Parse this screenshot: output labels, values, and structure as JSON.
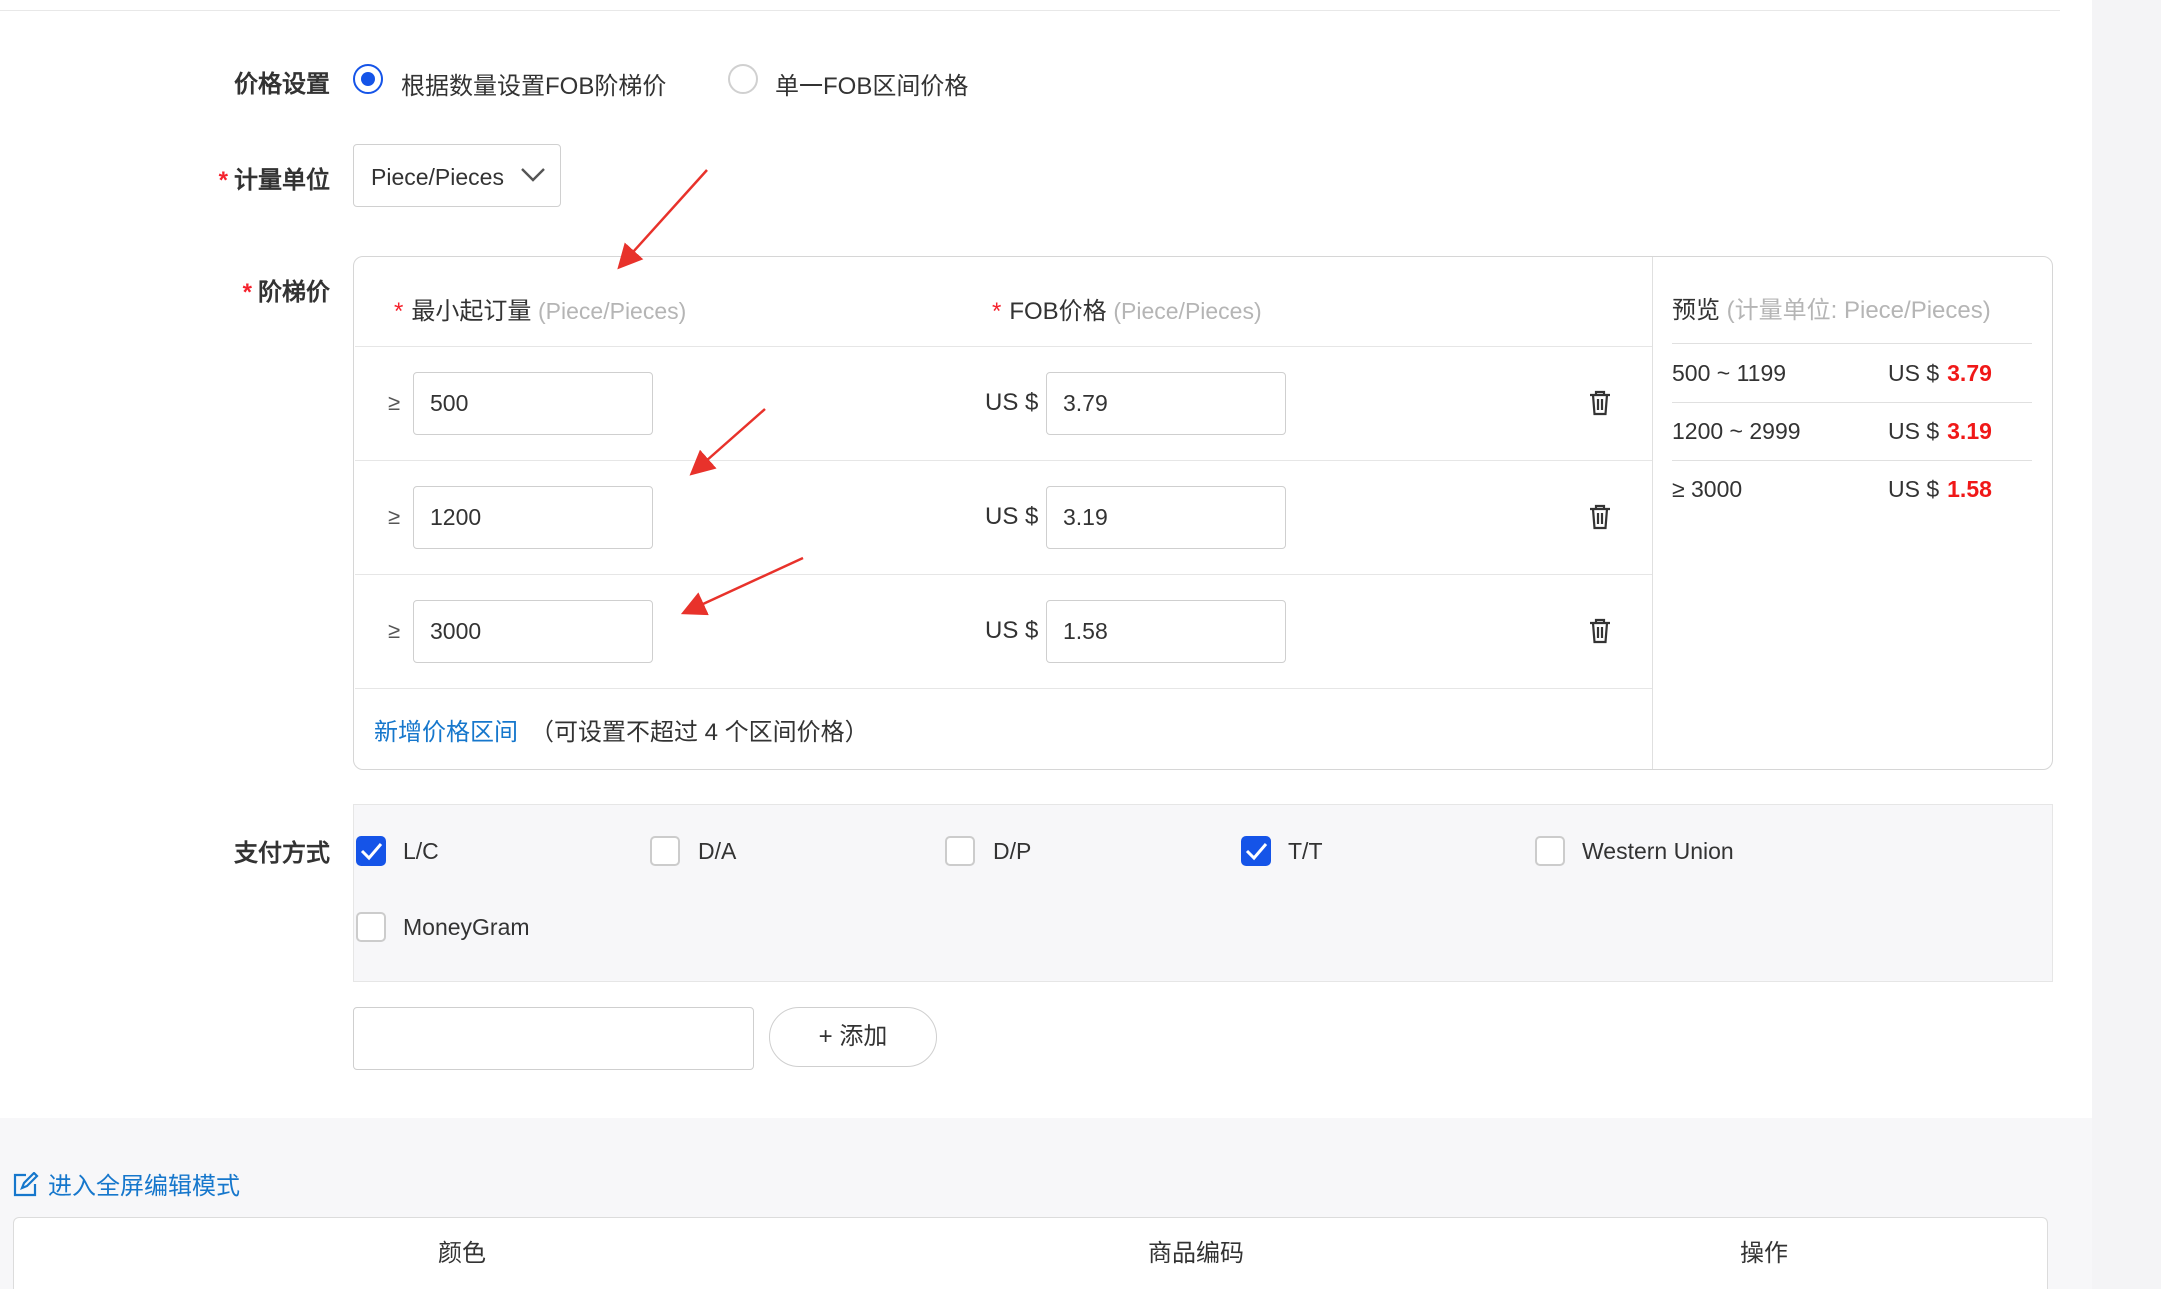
{
  "pricing": {
    "label": "价格设置",
    "options": [
      {
        "label": "根据数量设置FOB阶梯价",
        "selected": true
      },
      {
        "label": "单一FOB区间价格",
        "selected": false
      }
    ]
  },
  "unit": {
    "required_mark": "*",
    "label": "计量单位",
    "value": "Piece/Pieces"
  },
  "tiers": {
    "required_mark": "*",
    "label": "阶梯价",
    "min_qty_header": "最小起订量",
    "min_qty_unit": "(Piece/Pieces)",
    "price_header": "FOB价格",
    "price_unit": "(Piece/Pieces)",
    "ge_symbol": "≥",
    "currency": "US $",
    "rows": [
      {
        "min_qty": "500",
        "price": "3.79"
      },
      {
        "min_qty": "1200",
        "price": "3.19"
      },
      {
        "min_qty": "3000",
        "price": "1.58"
      }
    ],
    "add_link": "新增价格区间",
    "add_hint": "（可设置不超过 4 个区间价格）"
  },
  "preview": {
    "title": "预览",
    "unit_note": "(计量单位: Piece/Pieces)",
    "currency": "US $",
    "rows": [
      {
        "range": "500 ~ 1199",
        "price": "3.79"
      },
      {
        "range": "1200 ~ 2999",
        "price": "3.19"
      },
      {
        "range": "≥ 3000",
        "price": "1.58"
      }
    ]
  },
  "payment": {
    "label": "支付方式",
    "methods": [
      {
        "label": "L/C",
        "checked": true
      },
      {
        "label": "D/A",
        "checked": false
      },
      {
        "label": "D/P",
        "checked": false
      },
      {
        "label": "T/T",
        "checked": true
      },
      {
        "label": "Western Union",
        "checked": false
      },
      {
        "label": "MoneyGram",
        "checked": false
      }
    ],
    "custom_input_value": "",
    "add_button": "+ 添加"
  },
  "fullscreen_link": "进入全屏编辑模式",
  "table": {
    "headers": [
      "颜色",
      "商品编码",
      "操作"
    ]
  },
  "colors": {
    "accent": "#1554e8",
    "link": "#1677cc",
    "price_red": "#f01818",
    "required_red": "#f5222d",
    "annotation_arrow": "#e8322b"
  }
}
